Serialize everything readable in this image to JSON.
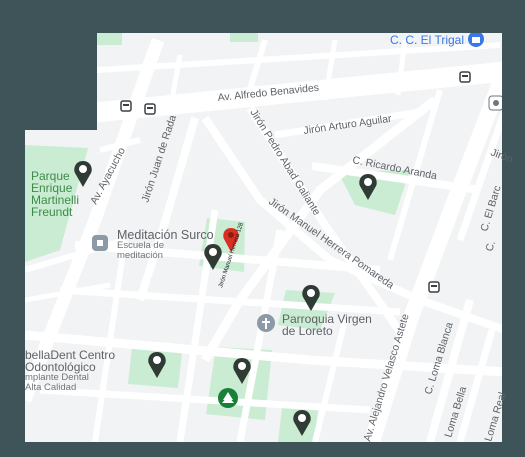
{
  "map": {
    "colors": {
      "frame": "#3f5459",
      "land": "#f1f3f4",
      "road": "#ffffff",
      "park": "#c9ecd2",
      "park_pin": "#2f3b34",
      "poi_pin": "#8b9aa6",
      "red_pin": "#d93025",
      "transit": "#3c4043",
      "blue": "#3b78e7"
    },
    "streets": [
      {
        "id": "av-alfredo-benavides",
        "label": "Av. Alfredo Benavides"
      },
      {
        "id": "av-ayacucho",
        "label": "Av. Ayacucho"
      },
      {
        "id": "jiron-juan-de-rada",
        "label": "Jirón Juan de Rada"
      },
      {
        "id": "jiron-pedro-abad-galiante",
        "label": "Jirón Pedro Abad Galiante"
      },
      {
        "id": "jiron-arturo-aguilar",
        "label": "Jirón Arturo Aguilar"
      },
      {
        "id": "c-ricardo-aranda",
        "label": "C. Ricardo Aranda"
      },
      {
        "id": "jiron-manuel-herrera-pomareda",
        "label": "Jirón Manuel Herrera Pomareda"
      },
      {
        "id": "av-alejandro-velasco-astete",
        "label": "Av. Alejandro Velasco Astete"
      },
      {
        "id": "c-loma-blanca",
        "label": "C. Loma Blanca"
      },
      {
        "id": "loma-bella",
        "label": "Loma Bella"
      },
      {
        "id": "loma-real",
        "label": "Loma Real"
      },
      {
        "id": "c-el-barco",
        "label": "C. El Barc"
      },
      {
        "id": "jiron-partial",
        "label": "Jirón"
      },
      {
        "id": "c-partial",
        "label": "C."
      },
      {
        "id": "pin-street",
        "label": "Jirón Manuel Herrera 128"
      }
    ],
    "places": {
      "parque": {
        "line1": "Parque",
        "line2": "Enrique",
        "line3": "Martinelli",
        "line4": "Freundt"
      },
      "meditacion": {
        "name": "Meditación Surco",
        "sub1": "Escuela de",
        "sub2": "meditación"
      },
      "parroquia": {
        "line1": "Parroquia Virgen",
        "line2": "de Loreto"
      },
      "cc": {
        "name": "C. C. El Trigal"
      },
      "dental": {
        "line1": "bellaDent Centro",
        "line2": "Odontológico",
        "sub1": "mplante Dental",
        "sub2": "Alta Calidad"
      }
    },
    "icons": [
      "park-pin-icon",
      "location-pin-icon",
      "church-icon",
      "transit-icon",
      "shopping-icon",
      "tree-icon",
      "info-icon"
    ]
  }
}
